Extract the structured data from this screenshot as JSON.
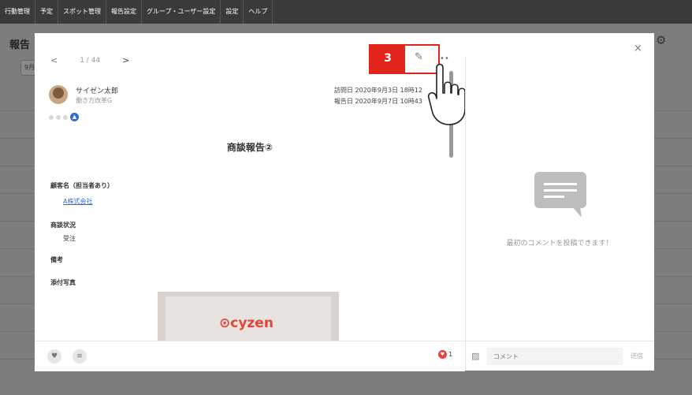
{
  "nav": [
    "行動管理",
    "予定",
    "スポット管理",
    "報告設定",
    "グループ・ユーザー設定",
    "設定",
    "ヘルプ"
  ],
  "background": {
    "title": "報告",
    "date_filter": "9月"
  },
  "modal": {
    "pager": {
      "prev": "<",
      "position": "1 / 44",
      "next": ">"
    },
    "close": "×",
    "author": {
      "name": "サイゼン太郎",
      "department": "働き方改革G"
    },
    "visit": "訪問日 2020年9月3日 18時12",
    "report_date": "報告日 2020年9月7日 10時43",
    "report_title": "商談報告②",
    "fields": [
      {
        "label": "顧客名（担当者あり）",
        "value": "A株式会社",
        "link": true
      },
      {
        "label": "商談状況",
        "value": "受注",
        "link": false
      },
      {
        "label": "備考",
        "value": "",
        "link": false
      },
      {
        "label": "添付写真",
        "value": "",
        "link": false
      }
    ],
    "photo_logo": "cyzen",
    "like_count": "1",
    "callout_number": "3",
    "more": "••",
    "empty_comments": "最初のコメントを投稿できます！",
    "comment_placeholder": "コメント",
    "send_label": "送信"
  }
}
